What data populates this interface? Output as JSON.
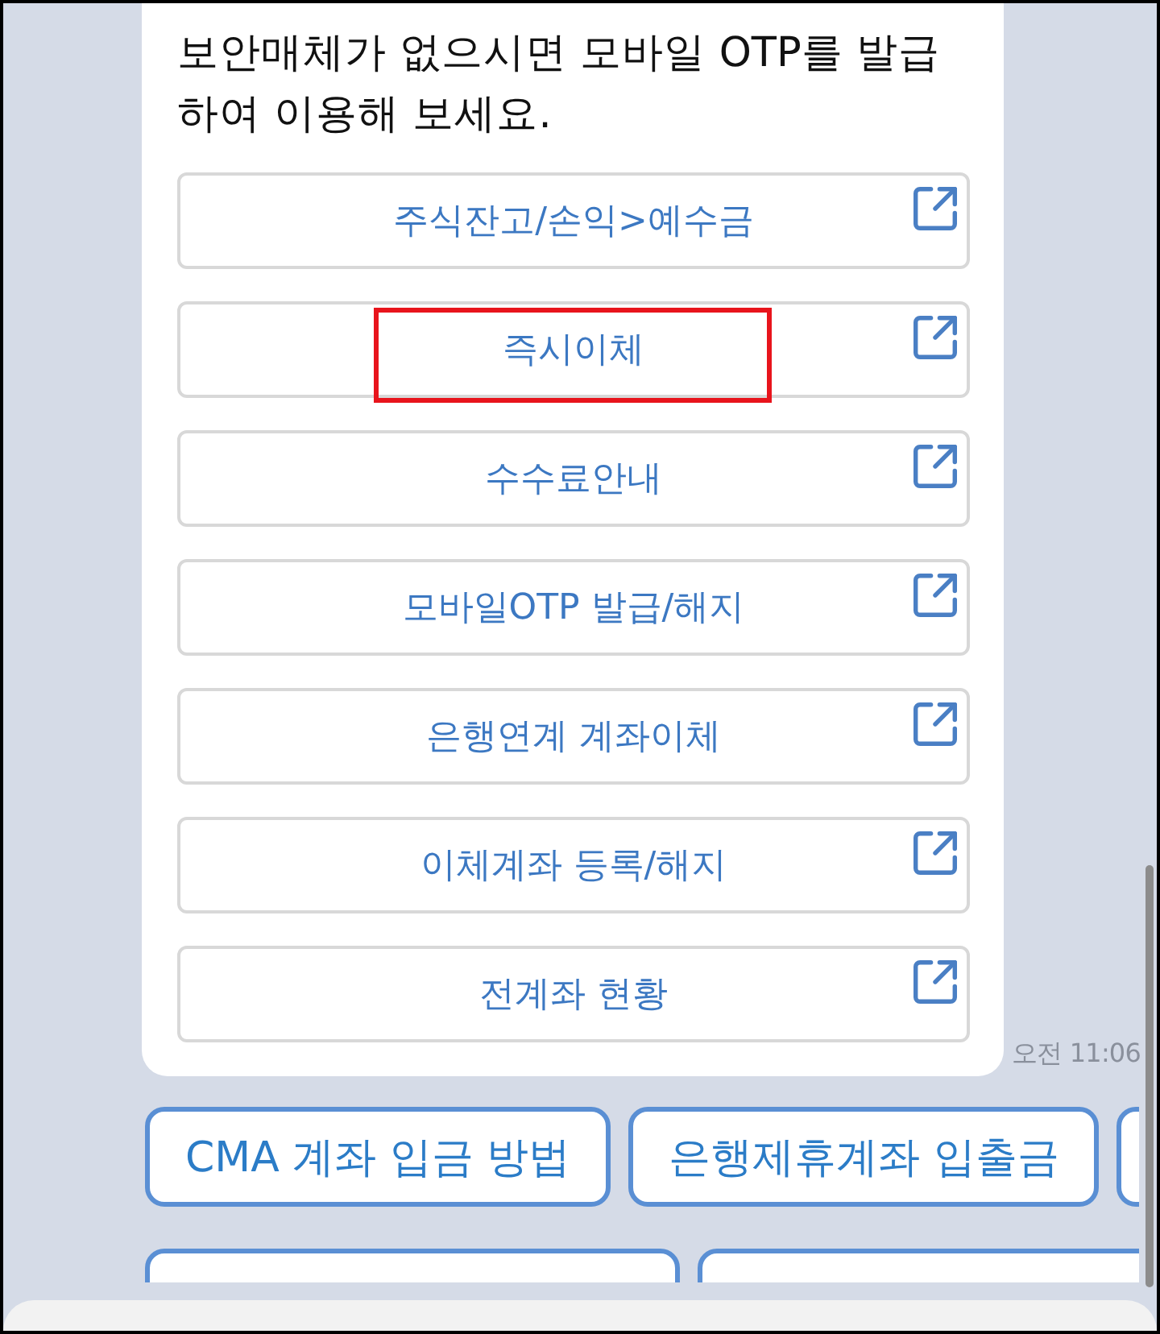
{
  "message": {
    "text": "보안매체가 없으시면 모바일 OTP를 발급하여 이용해 보세요.",
    "time": "오전 11:06"
  },
  "links": [
    {
      "label": "주식잔고/손익>예수금",
      "highlighted": false
    },
    {
      "label": "즉시이체",
      "highlighted": true
    },
    {
      "label": "수수료안내",
      "highlighted": false
    },
    {
      "label": "모바일OTP 발급/해지",
      "highlighted": false
    },
    {
      "label": "은행연계 계좌이체",
      "highlighted": false
    },
    {
      "label": "이체계좌 등록/해지",
      "highlighted": false
    },
    {
      "label": "전계좌 현황",
      "highlighted": false
    }
  ],
  "quick_reply_rows": [
    [
      {
        "label": "CMA 계좌 입금 방법",
        "cut_off": false
      },
      {
        "label": "은행제휴계좌 입출금",
        "cut_off": false
      },
      {
        "cut_off": true
      }
    ],
    [
      {
        "cut_off": true
      },
      {
        "cut_off": true
      }
    ]
  ]
}
